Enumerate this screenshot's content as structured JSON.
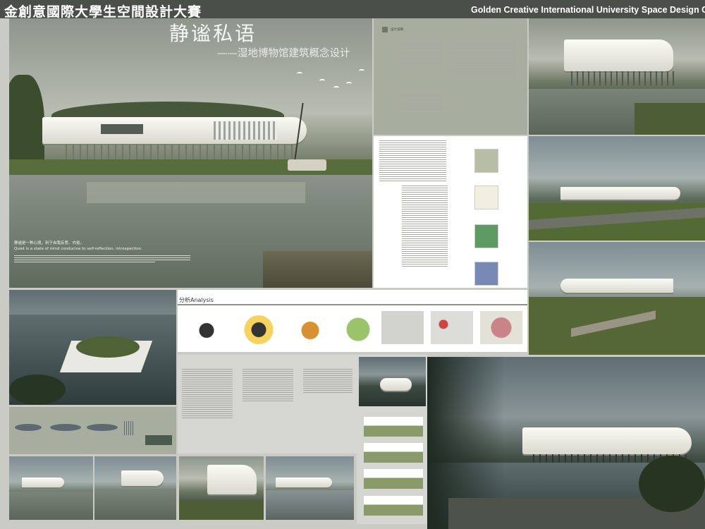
{
  "header": {
    "title_cn": "金創意國際大學生空間設計大賽",
    "title_en": "Golden Creative International University Space Design Competi"
  },
  "hero": {
    "title": "静谧私语",
    "subtitle": "——湿地博物馆建筑概念设计",
    "caption_cn": "静谧是一种心境，利于自我反思、内省。",
    "caption_en": "Quiet is a state of mind conducive to self-reflection, introspection."
  },
  "design_panel": {
    "label": "设计说明"
  },
  "analysis": {
    "title": "分析Analysis"
  },
  "colors": {
    "header_bg": "#4a4f4a",
    "board_bg": "#c9cbc4",
    "panel_green": "#a7ae9f"
  }
}
